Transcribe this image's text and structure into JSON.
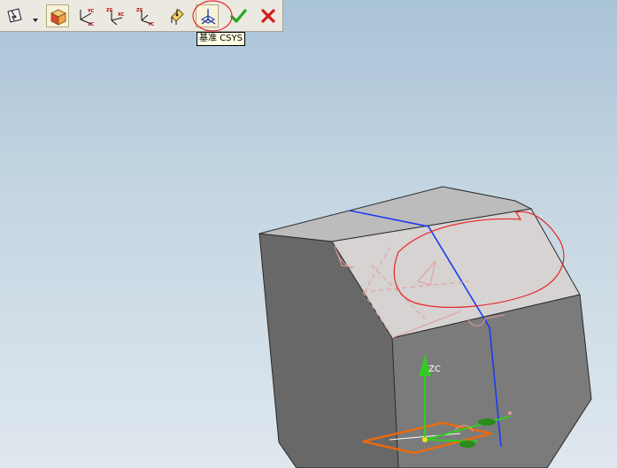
{
  "toolbar": {
    "buttons": [
      {
        "id": "orient",
        "icon": "csys-orient-icon"
      },
      {
        "id": "dropdown",
        "icon": "chevron-down-icon"
      },
      {
        "id": "shaded-cube",
        "icon": "shaded-cube-icon",
        "pressed": true
      },
      {
        "id": "xc-yc",
        "icon": "xc-yc-plane-icon",
        "labels": [
          "YC",
          "XC"
        ]
      },
      {
        "id": "xc-zc",
        "icon": "xc-zc-plane-icon",
        "labels": [
          "ZC",
          "XC"
        ]
      },
      {
        "id": "yc-zc",
        "icon": "yc-zc-plane-icon",
        "labels": [
          "ZC",
          "YC"
        ]
      },
      {
        "id": "point-on-face",
        "icon": "point-on-face-icon"
      },
      {
        "id": "datum-csys",
        "icon": "datum-csys-icon"
      },
      {
        "id": "ok",
        "icon": "green-check-icon",
        "color": "#22a722"
      },
      {
        "id": "cancel",
        "icon": "red-x-icon",
        "color": "#d21e1e"
      }
    ]
  },
  "tooltip": {
    "text": "基准 CSYS"
  },
  "viewport": {
    "axis_label": "ZC",
    "colors": {
      "face_left": "#6a6a6a",
      "face_front": "#7c7c7c",
      "face_top": "#bdbdbd",
      "face_chamfer": "#d6d3d2",
      "edge_highlight": "#1a3cf0",
      "annotation_red": "#e8262a",
      "datum_plane": "#ef6a0a",
      "axis_green": "#33cc22",
      "preview_pink": "#e39b9b"
    }
  }
}
